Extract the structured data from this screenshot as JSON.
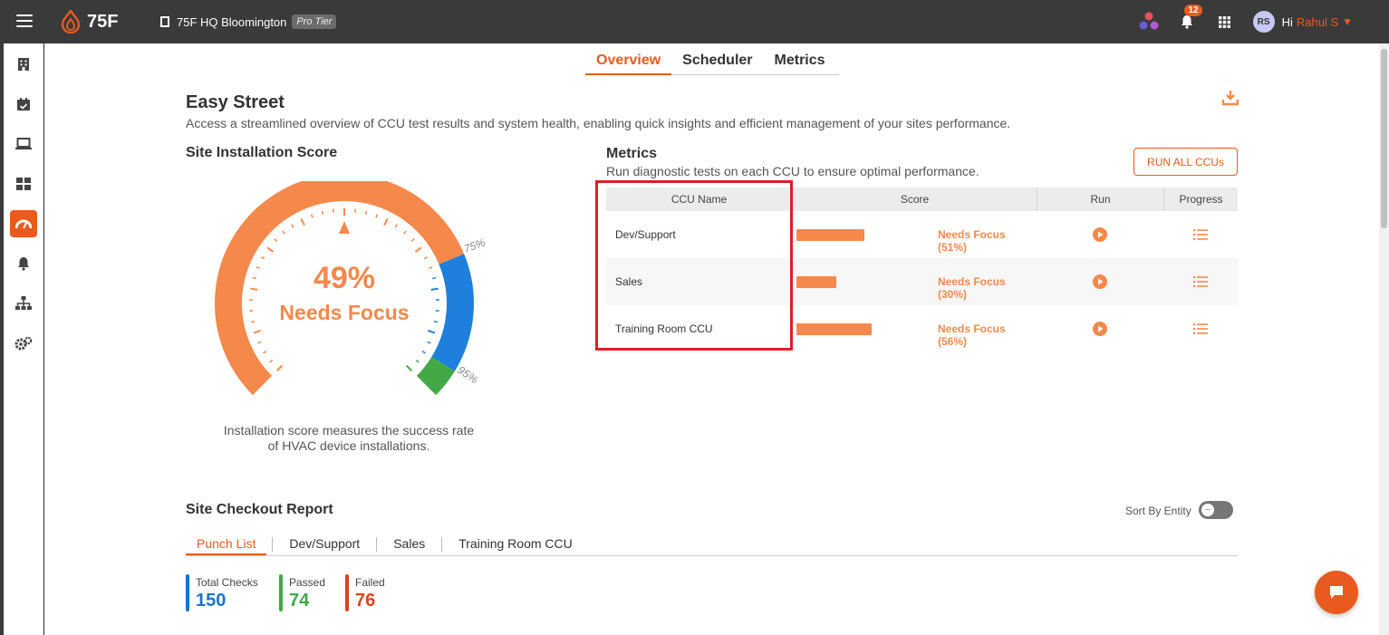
{
  "app": {
    "logo_text": "75F",
    "site_name": "75F HQ Bloomington",
    "tier_badge": "Pro Tier",
    "notification_count": "12",
    "user_initials": "RS",
    "greeting": "Hi",
    "user_name": "Rahul S"
  },
  "tabs": [
    {
      "label": "Overview",
      "active": true
    },
    {
      "label": "Scheduler",
      "active": false
    },
    {
      "label": "Metrics",
      "active": false
    }
  ],
  "page": {
    "title": "Easy Street",
    "description": "Access a streamlined overview of CCU test results and system health, enabling quick insights and efficient management of your sites performance."
  },
  "installation": {
    "title": "Site Installation Score",
    "score_pct": "49%",
    "score_value": 49,
    "status": "Needs Focus",
    "tick_75": "75%",
    "tick_95": "95%",
    "note_line1": "Installation score measures the success rate",
    "note_line2": "of HVAC device installations."
  },
  "metrics": {
    "title": "Metrics",
    "description": "Run diagnostic tests on each CCU to ensure optimal performance.",
    "run_all_label": "RUN ALL CCUs",
    "columns": [
      "CCU Name",
      "Score",
      "Run",
      "Progress"
    ],
    "rows": [
      {
        "name": "Dev/Support",
        "score": 51,
        "status": "Needs Focus (51%)"
      },
      {
        "name": "Sales",
        "score": 30,
        "status": "Needs Focus (30%)"
      },
      {
        "name": "Training Room CCU",
        "score": 56,
        "status": "Needs Focus (56%)"
      }
    ]
  },
  "checkout": {
    "title": "Site Checkout Report",
    "sort_label": "Sort By Entity",
    "tabs": [
      "Punch List",
      "Dev/Support",
      "Sales",
      "Training Room CCU"
    ],
    "stats": [
      {
        "label": "Total Checks",
        "value": "150",
        "color": "#1a73c8"
      },
      {
        "label": "Passed",
        "value": "74",
        "color": "#3da849"
      },
      {
        "label": "Failed",
        "value": "76",
        "color": "#d9441c"
      }
    ]
  },
  "colors": {
    "accent": "#e85a1d",
    "gauge_orange": "#f5894b",
    "gauge_blue": "#1f7fdc",
    "gauge_green": "#43a947"
  }
}
